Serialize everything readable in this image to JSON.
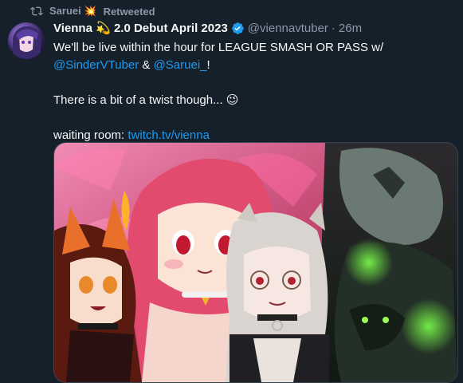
{
  "retweet": {
    "user": "Saruei",
    "emoji": "💥",
    "label": "Retweeted"
  },
  "tweet": {
    "display_name": "Vienna",
    "name_emoji": "💫",
    "name_suffix": "2.0 Debut April 2023",
    "handle": "@viennavtuber",
    "separator": "·",
    "time": "26m",
    "line1": "We'll be live within the hour for LEAGUE SMASH OR PASS w/",
    "mention1": "@SinderVTuber",
    "amp": " & ",
    "mention2": "@Saruei_",
    "exclaim": "!",
    "line2": "There is a bit of a twist though...",
    "line2_emoji": "😉",
    "line3_prefix": "waiting room: ",
    "link": "twitch.tv/vienna"
  },
  "colors": {
    "background": "#15202b",
    "text": "#f7f9f9",
    "muted": "#8b98a5",
    "link": "#1d9bf0"
  },
  "icons": {
    "retweet": "retweet-icon",
    "verified": "verified-badge-icon"
  }
}
